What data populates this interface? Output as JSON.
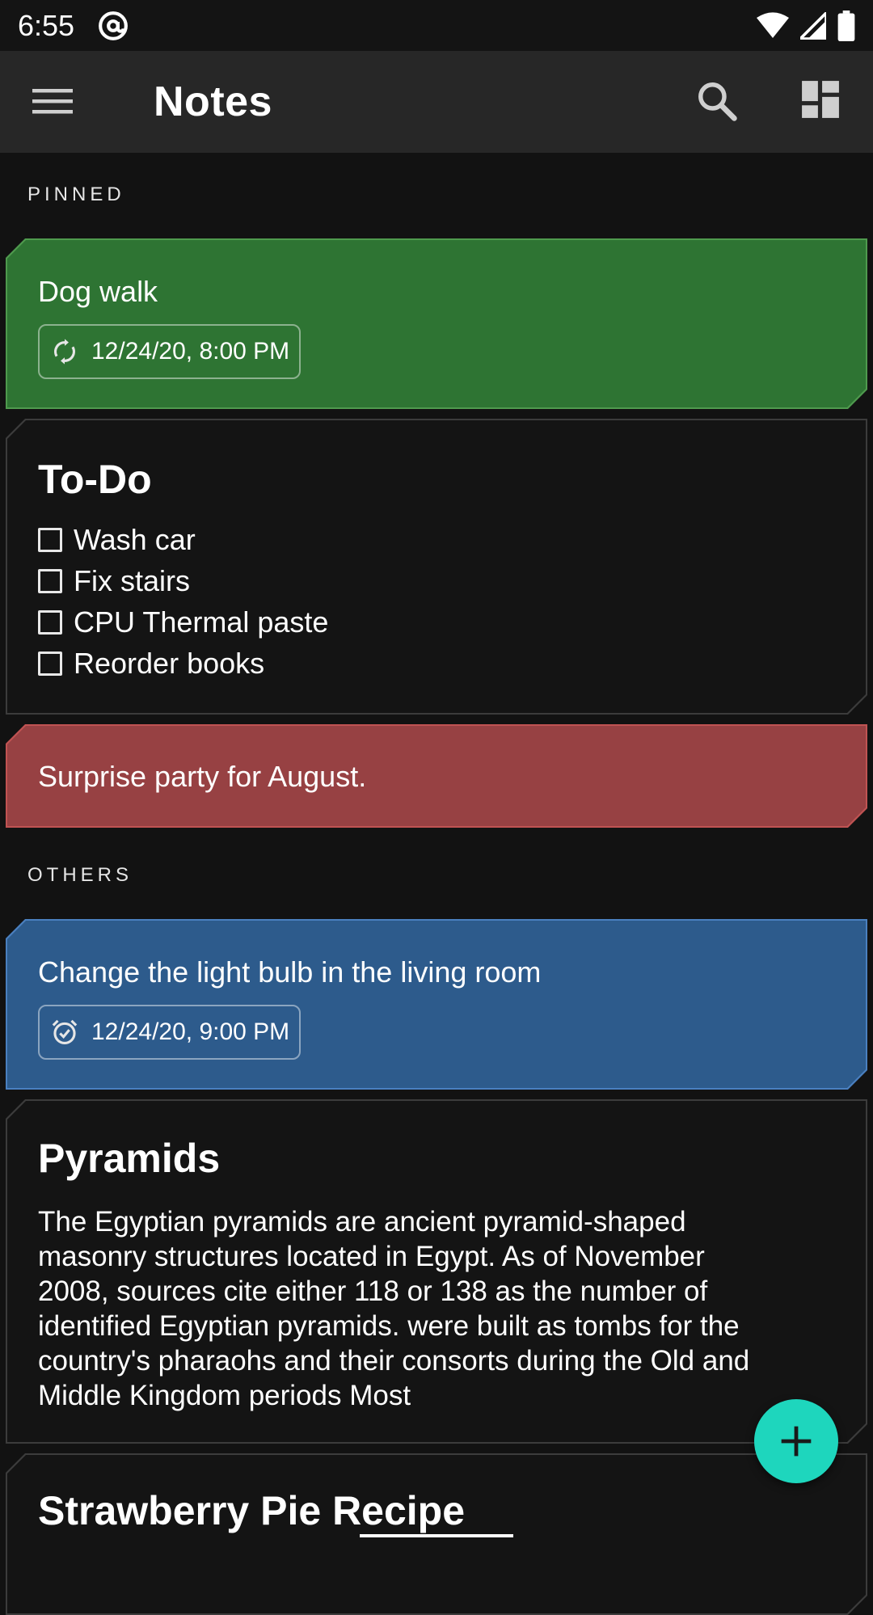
{
  "status_bar": {
    "time": "6:55",
    "icons": [
      "at-sign-icon",
      "wifi-icon",
      "signal-icon",
      "battery-icon"
    ]
  },
  "toolbar": {
    "title": "Notes",
    "icons": [
      "menu-icon",
      "search-icon",
      "dashboard-layout-icon"
    ]
  },
  "sections": {
    "pinned": "PINNED",
    "others": "OTHERS"
  },
  "notes": {
    "dog_walk": {
      "text": "Dog walk",
      "reminder": "12/24/20, 8:00 PM",
      "reminder_icon": "repeat-icon",
      "color": "#2e7433"
    },
    "todo": {
      "title": "To-Do",
      "items": [
        "Wash car",
        "Fix stairs",
        "CPU Thermal paste",
        "Reorder books"
      ]
    },
    "surprise": {
      "text": "Surprise party for August.",
      "color": "#974143"
    },
    "light_bulb": {
      "text": "Change the light bulb in the living room",
      "reminder": "12/24/20, 9:00 PM",
      "reminder_icon": "alarm-icon",
      "color": "#2d5b8c"
    },
    "pyramids": {
      "title": "Pyramids",
      "lines": [
        "The Egyptian pyramids are ancient pyramid-shaped",
        "masonry structures located in Egypt. As of November",
        "2008, sources cite either 118 or 138 as the number of",
        "identified Egyptian pyramids. were built as tombs for the",
        "country's pharaohs and their consorts during the Old and",
        "Middle Kingdom periods Most"
      ]
    },
    "strawberry": {
      "title": "Strawberry Pie Recipe"
    }
  },
  "fab": {
    "icon": "plus-icon",
    "color": "#1ed6bd"
  }
}
